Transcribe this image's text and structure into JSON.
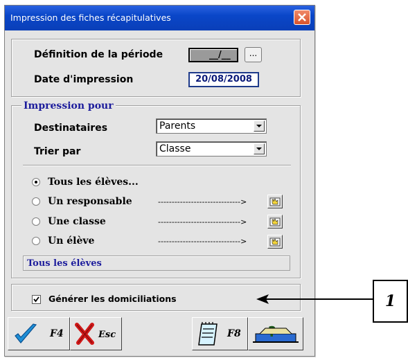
{
  "window": {
    "title": "Impression des fiches récapitulatives"
  },
  "period": {
    "label": "Définition de la période",
    "value": "__/__",
    "browse_label": "..."
  },
  "print_date": {
    "label": "Date d'impression",
    "value": "20/08/2008"
  },
  "group": {
    "legend": "Impression pour",
    "recipients": {
      "label": "Destinataires",
      "selected": "Parents"
    },
    "sort_by": {
      "label": "Trier par",
      "selected": "Classe"
    },
    "options": [
      {
        "label": "Tous les élèves...",
        "selected": true,
        "arrow": ""
      },
      {
        "label": "Un responsable",
        "selected": false,
        "arrow": "------------------------------>"
      },
      {
        "label": "Une classe",
        "selected": false,
        "arrow": "------------------------------>"
      },
      {
        "label": "Un élève",
        "selected": false,
        "arrow": "------------------------------>"
      }
    ],
    "status_text": "Tous les élèves"
  },
  "generate": {
    "label": "Générer les domiciliations",
    "checked": true
  },
  "buttons": {
    "ok_key": "F4",
    "cancel_key": "Esc",
    "print_key": "F8"
  },
  "callout": {
    "number": "1"
  },
  "colors": {
    "title_bar": "#0a46c8",
    "accent_text": "#1c1c9c",
    "window_bg": "#e4e4e4"
  }
}
